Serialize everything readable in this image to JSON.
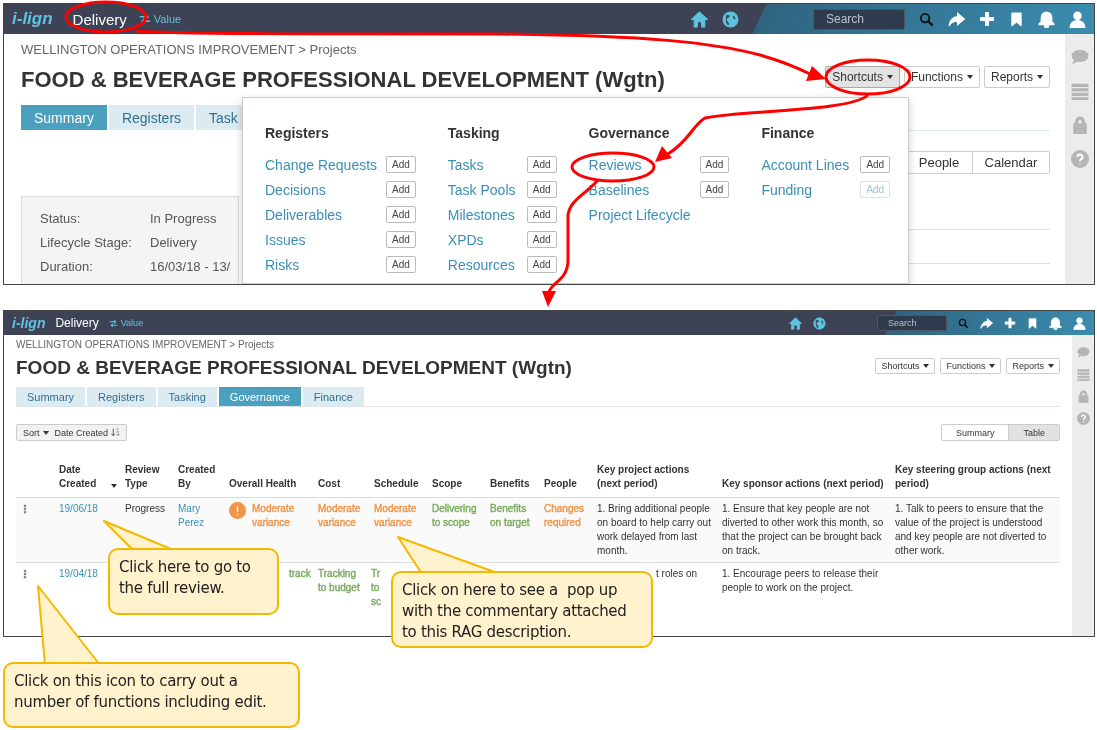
{
  "top_screen": {
    "header": {
      "logo": "i-lign",
      "module": "Delivery",
      "switch": "Value",
      "search": {
        "placeholder": "Search"
      }
    },
    "breadcrumb": "WELLINGTON OPERATIONS IMPROVEMENT > Projects",
    "title": "FOOD & BEVERAGE PROFESSIONAL DEVELOPMENT (Wgtn)",
    "actions": [
      {
        "label": "Shortcuts",
        "selected": true
      },
      {
        "label": "Functions",
        "selected": false
      },
      {
        "label": "Reports",
        "selected": false
      }
    ],
    "tabs": [
      {
        "label": "Summary",
        "selected": true
      },
      {
        "label": "Registers",
        "selected": false
      },
      {
        "label": "Task",
        "selected": false
      }
    ],
    "view_toggle": [
      {
        "label": "People",
        "selected": false
      },
      {
        "label": "Calendar",
        "selected": false
      }
    ],
    "details": [
      {
        "label": "Status:",
        "value": "In Progress"
      },
      {
        "label": "Lifecycle Stage:",
        "value": "Delivery"
      },
      {
        "label": "Duration:",
        "value": "16/03/18 - 13/"
      }
    ],
    "shortcuts_menu": [
      {
        "heading": "Registers",
        "items": [
          {
            "label": "Change Requests",
            "add": "Add",
            "disabled": false
          },
          {
            "label": "Decisions",
            "add": "Add",
            "disabled": false
          },
          {
            "label": "Deliverables",
            "add": "Add",
            "disabled": false
          },
          {
            "label": "Issues",
            "add": "Add",
            "disabled": false
          },
          {
            "label": "Risks",
            "add": "Add",
            "disabled": false
          }
        ]
      },
      {
        "heading": "Tasking",
        "items": [
          {
            "label": "Tasks",
            "add": "Add",
            "disabled": false
          },
          {
            "label": "Task Pools",
            "add": "Add",
            "disabled": false
          },
          {
            "label": "Milestones",
            "add": "Add",
            "disabled": false
          },
          {
            "label": "XPDs",
            "add": "Add",
            "disabled": false
          },
          {
            "label": "Resources",
            "add": "Add",
            "disabled": false
          }
        ]
      },
      {
        "heading": "Governance",
        "items": [
          {
            "label": "Reviews",
            "add": "Add",
            "disabled": false
          },
          {
            "label": "Baselines",
            "add": "Add",
            "disabled": false
          },
          {
            "label": "Project Lifecycle"
          }
        ]
      },
      {
        "heading": "Finance",
        "items": [
          {
            "label": "Account Lines",
            "add": "Add",
            "disabled": false
          },
          {
            "label": "Funding",
            "add": "Add",
            "disabled": true
          }
        ]
      }
    ]
  },
  "bottom_screen": {
    "header": {
      "logo": "i-lign",
      "module": "Delivery",
      "switch": "Value",
      "search": {
        "placeholder": "Search"
      }
    },
    "breadcrumb": "WELLINGTON OPERATIONS IMPROVEMENT > Projects",
    "title": "FOOD & BEVERAGE PROFESSIONAL DEVELOPMENT (Wgtn)",
    "actions": [
      {
        "label": "Shortcuts",
        "selected": false
      },
      {
        "label": "Functions",
        "selected": false
      },
      {
        "label": "Reports",
        "selected": false
      }
    ],
    "tabs": [
      {
        "label": "Summary",
        "selected": false
      },
      {
        "label": "Registers",
        "selected": false
      },
      {
        "label": "Tasking",
        "selected": false
      },
      {
        "label": "Governance",
        "selected": true
      },
      {
        "label": "Finance",
        "selected": false
      }
    ],
    "sort": {
      "label": "Sort",
      "field": "Date Created"
    },
    "view_toggle": [
      {
        "label": "Summary",
        "selected": false
      },
      {
        "label": "Table",
        "selected": true
      }
    ],
    "table": {
      "columns": [
        {
          "label": "Date Created",
          "sorted": true
        },
        {
          "label": "Review Type",
          "sorted": false
        },
        {
          "label": "Created By",
          "sorted": false
        },
        {
          "label": "Overall Health",
          "sorted": false
        },
        {
          "label": "Cost",
          "sorted": false
        },
        {
          "label": "Schedule",
          "sorted": false
        },
        {
          "label": "Scope",
          "sorted": false
        },
        {
          "label": "Benefits",
          "sorted": false
        },
        {
          "label": "People",
          "sorted": false
        },
        {
          "label": "Key project actions (next period)",
          "sorted": false
        },
        {
          "label": "Key sponsor actions (next period)",
          "sorted": false
        },
        {
          "label": "Key steering group actions (next period)",
          "sorted": false
        }
      ],
      "rows": [
        {
          "cells": [
            {
              "text": "19/06/18",
              "kind": "link"
            },
            {
              "text": "Progress",
              "kind": "plain"
            },
            {
              "text": "Mary Perez",
              "kind": "link"
            },
            {
              "text": "Moderate variance",
              "kind": "rag",
              "color": "#f0954a",
              "alert": true
            },
            {
              "text": "Moderate variance",
              "kind": "rag",
              "color": "#f0954a"
            },
            {
              "text": "Moderate variance",
              "kind": "rag",
              "color": "#f0954a"
            },
            {
              "text": "Delivering to scope",
              "kind": "rag",
              "color": "#7aab5e"
            },
            {
              "text": "Benefits on target",
              "kind": "rag",
              "color": "#7aab5e"
            },
            {
              "text": "Changes required",
              "kind": "rag",
              "color": "#f0954a"
            },
            {
              "text": "1. Bring additional people on board to help carry out work delayed from last month.",
              "kind": "plain"
            },
            {
              "text": "1. Ensure that key people are not diverted to other work this month, so that the project can be brought back on track.",
              "kind": "plain"
            },
            {
              "text": "1. Talk to peers to ensure that the value of the project is understood and key people are not diverted to other work.",
              "kind": "plain"
            }
          ]
        },
        {
          "cells": [
            {
              "text": "19/04/18",
              "kind": "link"
            },
            null,
            null,
            {
              "text": "track",
              "kind": "rag",
              "color": "#7aab5e"
            },
            {
              "text": "Tracking to budget",
              "kind": "rag",
              "color": "#7aab5e"
            },
            {
              "text": "Tr to sc",
              "kind": "rag",
              "color": "#7aab5e"
            },
            null,
            null,
            null,
            {
              "text": "t roles on",
              "kind": "plain"
            },
            {
              "text": "1. Encourage peers to release their people to work on the project.",
              "kind": "plain"
            },
            null
          ]
        }
      ]
    }
  },
  "callouts": [
    {
      "text": "Click here to go to the full review."
    },
    {
      "text": "Click on here to see a  pop up with the commentary attached to this RAG description."
    },
    {
      "text": "Click on this icon to carry out a number of functions including edit."
    }
  ]
}
